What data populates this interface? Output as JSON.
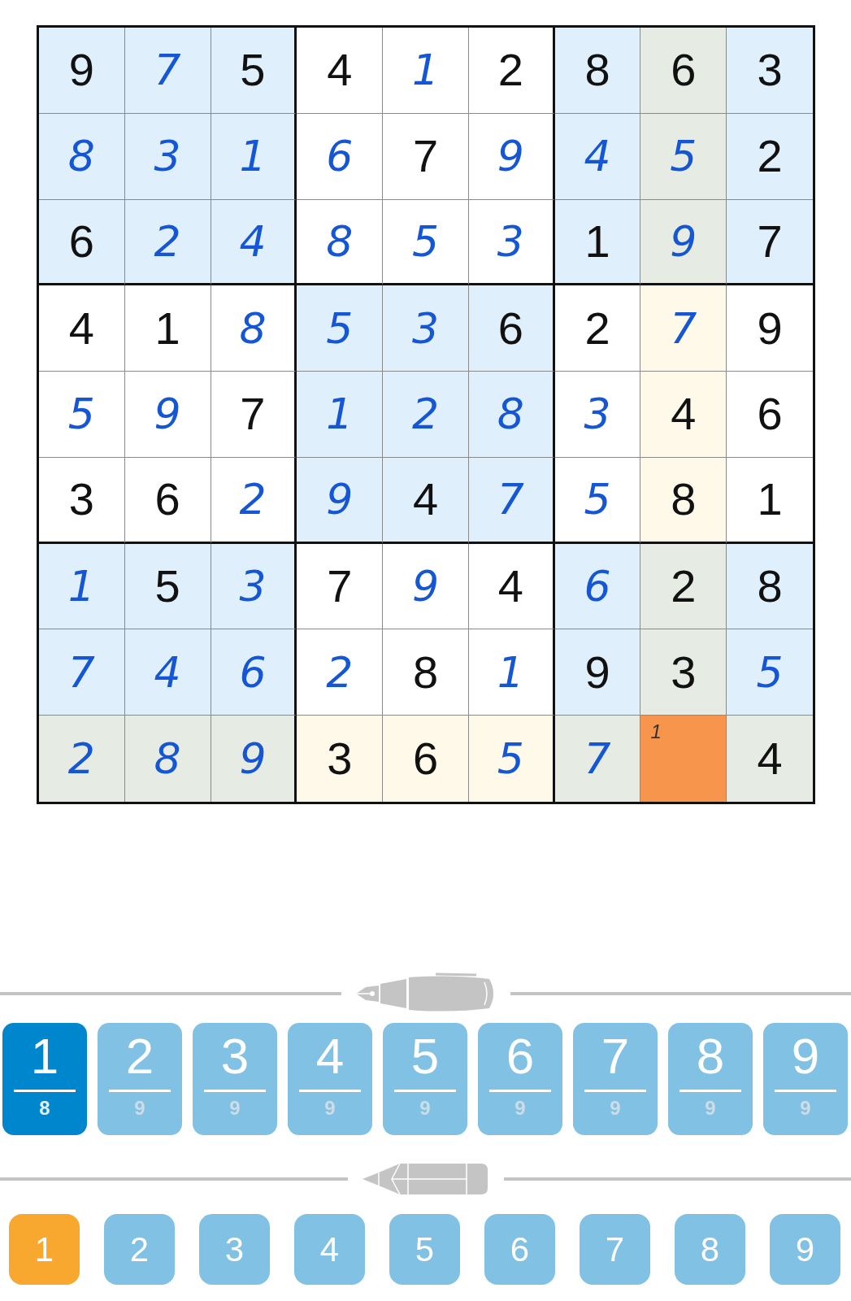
{
  "grid": {
    "rows": [
      {
        "cells": [
          {
            "value": "9",
            "kind": "given",
            "shaded": true,
            "highlighted": false,
            "selected": false
          },
          {
            "value": "7",
            "kind": "entered",
            "shaded": true,
            "highlighted": false,
            "selected": false
          },
          {
            "value": "5",
            "kind": "given",
            "shaded": true,
            "highlighted": false,
            "selected": false
          },
          {
            "value": "4",
            "kind": "given",
            "shaded": false,
            "highlighted": false,
            "selected": false
          },
          {
            "value": "1",
            "kind": "entered",
            "shaded": false,
            "highlighted": false,
            "selected": false
          },
          {
            "value": "2",
            "kind": "given",
            "shaded": false,
            "highlighted": false,
            "selected": false
          },
          {
            "value": "8",
            "kind": "given",
            "shaded": true,
            "highlighted": false,
            "selected": false
          },
          {
            "value": "6",
            "kind": "given",
            "shaded": true,
            "highlighted": true,
            "selected": false
          },
          {
            "value": "3",
            "kind": "given",
            "shaded": true,
            "highlighted": false,
            "selected": false
          }
        ]
      },
      {
        "cells": [
          {
            "value": "8",
            "kind": "entered",
            "shaded": true,
            "highlighted": false,
            "selected": false
          },
          {
            "value": "3",
            "kind": "entered",
            "shaded": true,
            "highlighted": false,
            "selected": false
          },
          {
            "value": "1",
            "kind": "entered",
            "shaded": true,
            "highlighted": false,
            "selected": false
          },
          {
            "value": "6",
            "kind": "entered",
            "shaded": false,
            "highlighted": false,
            "selected": false
          },
          {
            "value": "7",
            "kind": "given",
            "shaded": false,
            "highlighted": false,
            "selected": false
          },
          {
            "value": "9",
            "kind": "entered",
            "shaded": false,
            "highlighted": false,
            "selected": false
          },
          {
            "value": "4",
            "kind": "entered",
            "shaded": true,
            "highlighted": false,
            "selected": false
          },
          {
            "value": "5",
            "kind": "entered",
            "shaded": true,
            "highlighted": true,
            "selected": false
          },
          {
            "value": "2",
            "kind": "given",
            "shaded": true,
            "highlighted": false,
            "selected": false
          }
        ]
      },
      {
        "cells": [
          {
            "value": "6",
            "kind": "given",
            "shaded": true,
            "highlighted": false,
            "selected": false
          },
          {
            "value": "2",
            "kind": "entered",
            "shaded": true,
            "highlighted": false,
            "selected": false
          },
          {
            "value": "4",
            "kind": "entered",
            "shaded": true,
            "highlighted": false,
            "selected": false
          },
          {
            "value": "8",
            "kind": "entered",
            "shaded": false,
            "highlighted": false,
            "selected": false
          },
          {
            "value": "5",
            "kind": "entered",
            "shaded": false,
            "highlighted": false,
            "selected": false
          },
          {
            "value": "3",
            "kind": "entered",
            "shaded": false,
            "highlighted": false,
            "selected": false
          },
          {
            "value": "1",
            "kind": "given",
            "shaded": true,
            "highlighted": false,
            "selected": false
          },
          {
            "value": "9",
            "kind": "entered",
            "shaded": true,
            "highlighted": true,
            "selected": false
          },
          {
            "value": "7",
            "kind": "given",
            "shaded": true,
            "highlighted": false,
            "selected": false
          }
        ]
      },
      {
        "cells": [
          {
            "value": "4",
            "kind": "given",
            "shaded": false,
            "highlighted": false,
            "selected": false
          },
          {
            "value": "1",
            "kind": "given",
            "shaded": false,
            "highlighted": false,
            "selected": false
          },
          {
            "value": "8",
            "kind": "entered",
            "shaded": false,
            "highlighted": false,
            "selected": false
          },
          {
            "value": "5",
            "kind": "entered",
            "shaded": true,
            "highlighted": false,
            "selected": false
          },
          {
            "value": "3",
            "kind": "entered",
            "shaded": true,
            "highlighted": false,
            "selected": false
          },
          {
            "value": "6",
            "kind": "given",
            "shaded": true,
            "highlighted": false,
            "selected": false
          },
          {
            "value": "2",
            "kind": "given",
            "shaded": false,
            "highlighted": false,
            "selected": false
          },
          {
            "value": "7",
            "kind": "entered",
            "shaded": false,
            "highlighted": true,
            "selected": false
          },
          {
            "value": "9",
            "kind": "given",
            "shaded": false,
            "highlighted": false,
            "selected": false
          }
        ]
      },
      {
        "cells": [
          {
            "value": "5",
            "kind": "entered",
            "shaded": false,
            "highlighted": false,
            "selected": false
          },
          {
            "value": "9",
            "kind": "entered",
            "shaded": false,
            "highlighted": false,
            "selected": false
          },
          {
            "value": "7",
            "kind": "given",
            "shaded": false,
            "highlighted": false,
            "selected": false
          },
          {
            "value": "1",
            "kind": "entered",
            "shaded": true,
            "highlighted": false,
            "selected": false
          },
          {
            "value": "2",
            "kind": "entered",
            "shaded": true,
            "highlighted": false,
            "selected": false
          },
          {
            "value": "8",
            "kind": "entered",
            "shaded": true,
            "highlighted": false,
            "selected": false
          },
          {
            "value": "3",
            "kind": "entered",
            "shaded": false,
            "highlighted": false,
            "selected": false
          },
          {
            "value": "4",
            "kind": "given",
            "shaded": false,
            "highlighted": true,
            "selected": false
          },
          {
            "value": "6",
            "kind": "given",
            "shaded": false,
            "highlighted": false,
            "selected": false
          }
        ]
      },
      {
        "cells": [
          {
            "value": "3",
            "kind": "given",
            "shaded": false,
            "highlighted": false,
            "selected": false
          },
          {
            "value": "6",
            "kind": "given",
            "shaded": false,
            "highlighted": false,
            "selected": false
          },
          {
            "value": "2",
            "kind": "entered",
            "shaded": false,
            "highlighted": false,
            "selected": false
          },
          {
            "value": "9",
            "kind": "entered",
            "shaded": true,
            "highlighted": false,
            "selected": false
          },
          {
            "value": "4",
            "kind": "given",
            "shaded": true,
            "highlighted": false,
            "selected": false
          },
          {
            "value": "7",
            "kind": "entered",
            "shaded": true,
            "highlighted": false,
            "selected": false
          },
          {
            "value": "5",
            "kind": "entered",
            "shaded": false,
            "highlighted": false,
            "selected": false
          },
          {
            "value": "8",
            "kind": "given",
            "shaded": false,
            "highlighted": true,
            "selected": false
          },
          {
            "value": "1",
            "kind": "given",
            "shaded": false,
            "highlighted": false,
            "selected": false
          }
        ]
      },
      {
        "cells": [
          {
            "value": "1",
            "kind": "entered",
            "shaded": true,
            "highlighted": false,
            "selected": false
          },
          {
            "value": "5",
            "kind": "given",
            "shaded": true,
            "highlighted": false,
            "selected": false
          },
          {
            "value": "3",
            "kind": "entered",
            "shaded": true,
            "highlighted": false,
            "selected": false
          },
          {
            "value": "7",
            "kind": "given",
            "shaded": false,
            "highlighted": false,
            "selected": false
          },
          {
            "value": "9",
            "kind": "entered",
            "shaded": false,
            "highlighted": false,
            "selected": false
          },
          {
            "value": "4",
            "kind": "given",
            "shaded": false,
            "highlighted": false,
            "selected": false
          },
          {
            "value": "6",
            "kind": "entered",
            "shaded": true,
            "highlighted": false,
            "selected": false
          },
          {
            "value": "2",
            "kind": "given",
            "shaded": true,
            "highlighted": true,
            "selected": false
          },
          {
            "value": "8",
            "kind": "given",
            "shaded": true,
            "highlighted": false,
            "selected": false
          }
        ]
      },
      {
        "cells": [
          {
            "value": "7",
            "kind": "entered",
            "shaded": true,
            "highlighted": false,
            "selected": false
          },
          {
            "value": "4",
            "kind": "entered",
            "shaded": true,
            "highlighted": false,
            "selected": false
          },
          {
            "value": "6",
            "kind": "entered",
            "shaded": true,
            "highlighted": false,
            "selected": false
          },
          {
            "value": "2",
            "kind": "entered",
            "shaded": false,
            "highlighted": false,
            "selected": false
          },
          {
            "value": "8",
            "kind": "given",
            "shaded": false,
            "highlighted": false,
            "selected": false
          },
          {
            "value": "1",
            "kind": "entered",
            "shaded": false,
            "highlighted": false,
            "selected": false
          },
          {
            "value": "9",
            "kind": "given",
            "shaded": true,
            "highlighted": false,
            "selected": false
          },
          {
            "value": "3",
            "kind": "given",
            "shaded": true,
            "highlighted": true,
            "selected": false
          },
          {
            "value": "5",
            "kind": "entered",
            "shaded": true,
            "highlighted": false,
            "selected": false
          }
        ]
      },
      {
        "cells": [
          {
            "value": "2",
            "kind": "entered",
            "shaded": true,
            "highlighted": true,
            "selected": false
          },
          {
            "value": "8",
            "kind": "entered",
            "shaded": true,
            "highlighted": true,
            "selected": false
          },
          {
            "value": "9",
            "kind": "entered",
            "shaded": true,
            "highlighted": true,
            "selected": false
          },
          {
            "value": "3",
            "kind": "given",
            "shaded": false,
            "highlighted": true,
            "selected": false
          },
          {
            "value": "6",
            "kind": "given",
            "shaded": false,
            "highlighted": true,
            "selected": false
          },
          {
            "value": "5",
            "kind": "entered",
            "shaded": false,
            "highlighted": true,
            "selected": false
          },
          {
            "value": "7",
            "kind": "entered",
            "shaded": true,
            "highlighted": true,
            "selected": false
          },
          {
            "kind": "notes",
            "notes": "1",
            "selected": true
          },
          {
            "value": "4",
            "kind": "given",
            "shaded": true,
            "highlighted": true,
            "selected": false
          }
        ]
      }
    ]
  },
  "pen_keys": [
    {
      "digit": "1",
      "count": "8",
      "selected": true
    },
    {
      "digit": "2",
      "count": "9",
      "selected": false
    },
    {
      "digit": "3",
      "count": "9",
      "selected": false
    },
    {
      "digit": "4",
      "count": "9",
      "selected": false
    },
    {
      "digit": "5",
      "count": "9",
      "selected": false
    },
    {
      "digit": "6",
      "count": "9",
      "selected": false
    },
    {
      "digit": "7",
      "count": "9",
      "selected": false
    },
    {
      "digit": "8",
      "count": "9",
      "selected": false
    },
    {
      "digit": "9",
      "count": "9",
      "selected": false
    }
  ],
  "pencil_keys": [
    {
      "digit": "1",
      "selected": true
    },
    {
      "digit": "2",
      "selected": false
    },
    {
      "digit": "3",
      "selected": false
    },
    {
      "digit": "4",
      "selected": false
    },
    {
      "digit": "5",
      "selected": false
    },
    {
      "digit": "6",
      "selected": false
    },
    {
      "digit": "7",
      "selected": false
    },
    {
      "digit": "8",
      "selected": false
    },
    {
      "digit": "9",
      "selected": false
    }
  ]
}
